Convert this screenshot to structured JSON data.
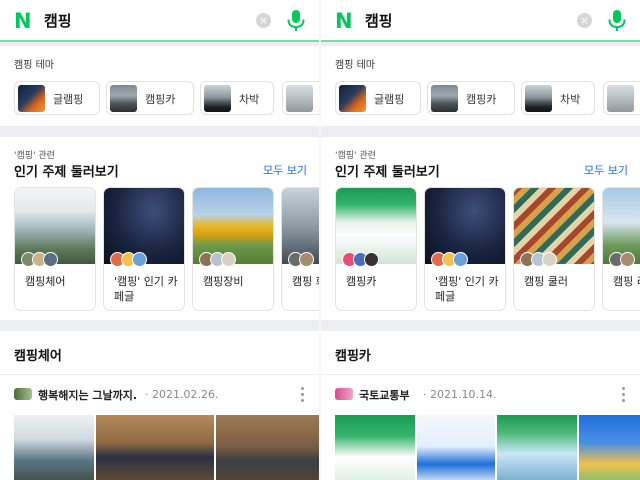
{
  "colors": {
    "brand": "#03c75a",
    "link": "#1e6fd9",
    "focus_line": "#7fd6a8"
  },
  "icons": {
    "logo": "naver-n-logo",
    "clear": "clear-icon",
    "mic": "microphone-icon",
    "more": "more-vertical-icon"
  },
  "panes": [
    {
      "search": {
        "logo_letter": "N",
        "query": "캠핑",
        "clear_glyph": "×"
      },
      "theme": {
        "title": "캠핑 테마",
        "chips": [
          {
            "label": "글램핑"
          },
          {
            "label": "캠핑카"
          },
          {
            "label": "차박"
          },
          {
            "label": ""
          }
        ]
      },
      "related": {
        "subtitle": "'캠핑' 관련",
        "title": "인기 주제 둘러보기",
        "more": "모두 보기",
        "tiles": [
          {
            "label": "캠핑체어"
          },
          {
            "label": "'캠핑' 인기 카페글"
          },
          {
            "label": "캠핑장비"
          },
          {
            "label": "캠핑 화"
          }
        ]
      },
      "section": {
        "title": "캠핑체어",
        "publisher": "행복해지는 그날까지.",
        "date": "· 2021.02.26."
      }
    },
    {
      "search": {
        "logo_letter": "N",
        "query": "캠핑",
        "clear_glyph": "×"
      },
      "theme": {
        "title": "캠핑 테마",
        "chips": [
          {
            "label": "글램핑"
          },
          {
            "label": "캠핑카"
          },
          {
            "label": "차박"
          },
          {
            "label": ""
          }
        ]
      },
      "related": {
        "subtitle": "'캠핑' 관련",
        "title": "인기 주제 둘러보기",
        "more": "모두 보기",
        "tiles": [
          {
            "label": "캠핑카"
          },
          {
            "label": "'캠핑' 인기 카페글"
          },
          {
            "label": "캠핑 쿨러"
          },
          {
            "label": "캠핑 리스트"
          }
        ]
      },
      "section": {
        "title": "캠핑카",
        "publisher": "국토교통부",
        "date": "· 2021.10.14."
      }
    }
  ]
}
